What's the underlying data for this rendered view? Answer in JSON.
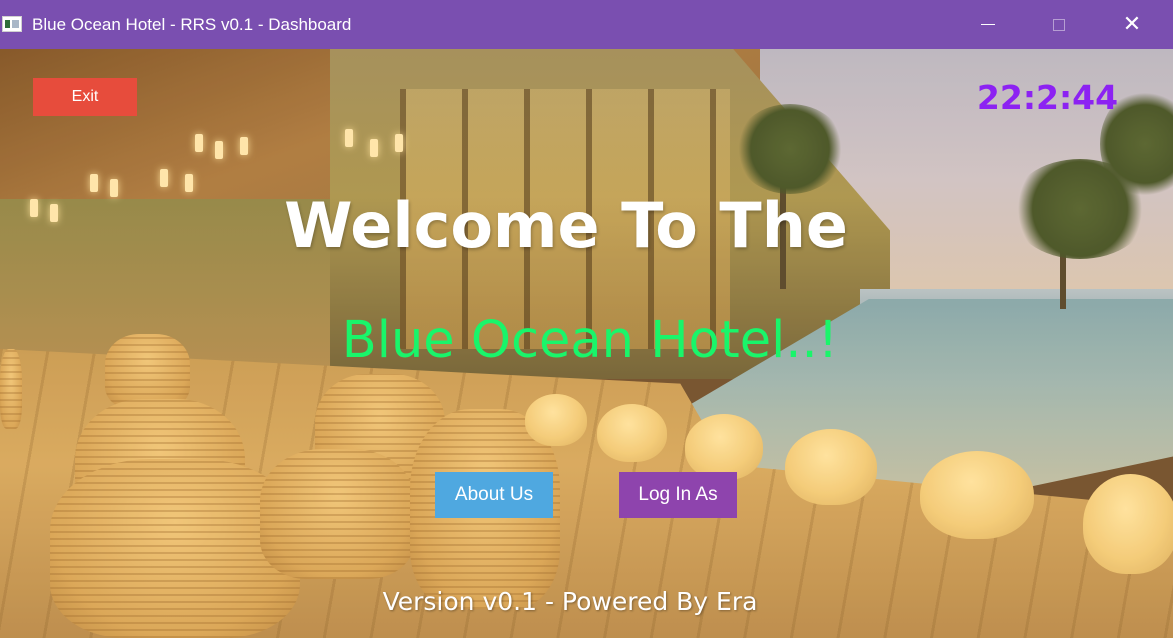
{
  "window": {
    "title": "Blue Ocean Hotel - RRS v0.1 - Dashboard",
    "app_icon": "app-window-icon",
    "controls": {
      "minimize_icon": "minimize-icon",
      "maximize_icon": "maximize-icon",
      "close_icon": "close-icon",
      "close_glyph": "✕"
    },
    "titlebar_color": "#7a4fb0"
  },
  "toolbar": {
    "exit_label": "Exit",
    "exit_color": "#e74c3c"
  },
  "clock": {
    "time": "22:2:44",
    "color": "#8c22f2"
  },
  "hero": {
    "welcome": "Welcome To The",
    "hotel_name": "Blue Ocean Hotel..!",
    "hotel_name_color": "#19f56a"
  },
  "actions": {
    "about_label": "About Us",
    "about_color": "#4fa8e0",
    "login_label": "Log In As",
    "login_color": "#8e44ad"
  },
  "footer": {
    "version": "Version v0.1 - Powered By Era"
  }
}
